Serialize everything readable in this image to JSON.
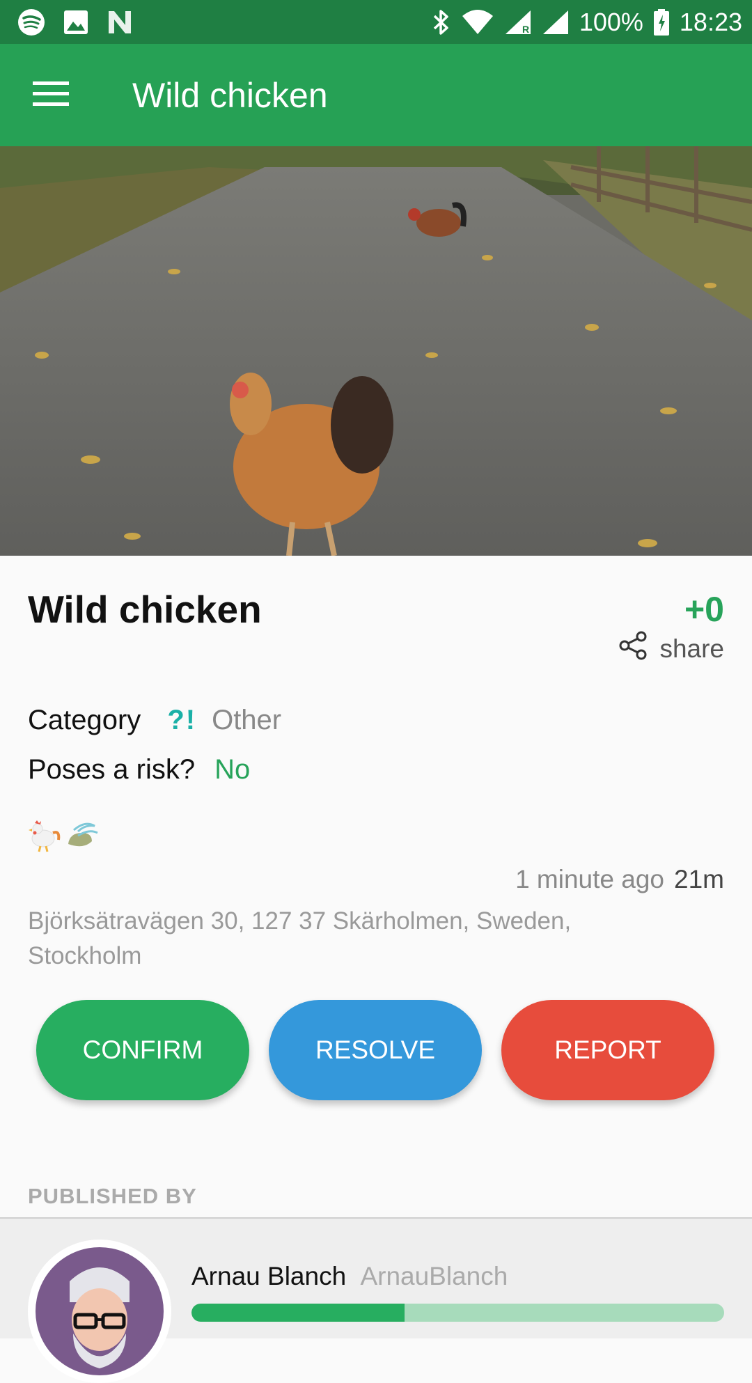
{
  "status_bar": {
    "battery": "100%",
    "time": "18:23",
    "icons_left": [
      "spotify-icon",
      "image-icon",
      "n-icon"
    ],
    "icons_right": [
      "bluetooth-icon",
      "wifi-icon",
      "signal-roaming-icon",
      "signal-icon",
      "battery-icon"
    ]
  },
  "app_bar": {
    "title": "Wild chicken",
    "menu_icon": "menu-icon"
  },
  "hero": {
    "description": "photo"
  },
  "details": {
    "title": "Wild chicken",
    "score": "+0",
    "share_label": "share",
    "category_label": "Category",
    "category_icon": "?!",
    "category_value": "Other",
    "risk_label": "Poses a risk?",
    "risk_value": "No",
    "emojis": [
      "rooster-icon",
      "leaf-wind-icon"
    ],
    "time_ago": "1 minute ago",
    "distance": "21m",
    "address": "Björksätravägen 30, 127 37 Skärholmen, Sweden, Stockholm"
  },
  "actions": {
    "confirm": "CONFIRM",
    "resolve": "RESOLVE",
    "report": "REPORT"
  },
  "publisher": {
    "section_label": "PUBLISHED BY",
    "name": "Arnau Blanch",
    "handle": "ArnauBlanch",
    "progress": 0.4
  },
  "colors": {
    "status_bar": "#1f7f43",
    "app_bar": "#26a155",
    "confirm": "#27ae60",
    "resolve": "#3498db",
    "report": "#e74c3c",
    "accent_green": "#27a35a",
    "category_icon": "#1ab0a7"
  }
}
